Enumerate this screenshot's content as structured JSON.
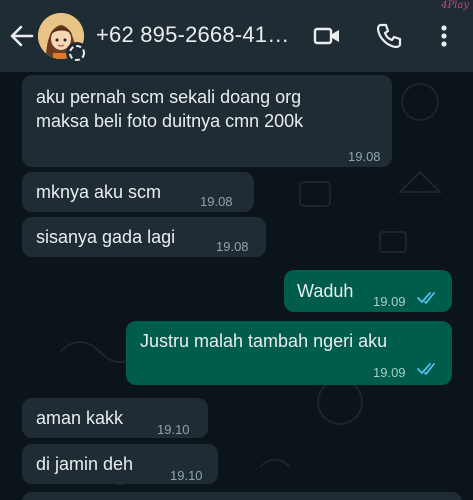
{
  "watermark": "4Play",
  "header": {
    "contact_name": "+62 895-2668-41…",
    "icons": [
      "back-arrow-icon",
      "video-call-icon",
      "voice-call-icon",
      "more-options-icon"
    ]
  },
  "messages": [
    {
      "direction": "in",
      "lines": [
        "aku pernah scm sekali doang org",
        "maksa beli foto duitnya cmn 200k"
      ],
      "time": "19.08"
    },
    {
      "direction": "in",
      "lines": [
        "mknya aku scm"
      ],
      "time": "19.08"
    },
    {
      "direction": "in",
      "lines": [
        "sisanya gada lagi"
      ],
      "time": "19.08"
    },
    {
      "direction": "out",
      "lines": [
        "Waduh"
      ],
      "time": "19.09",
      "status": "read"
    },
    {
      "direction": "out",
      "lines": [
        "Justru malah tambah ngeri aku"
      ],
      "time": "19.09",
      "status": "read"
    },
    {
      "direction": "in",
      "lines": [
        "aman kakk"
      ],
      "time": "19.10"
    },
    {
      "direction": "in",
      "lines": [
        "di jamin deh"
      ],
      "time": "19.10"
    }
  ],
  "colors": {
    "header_bg": "#202c33",
    "chat_bg": "#0b141a",
    "incoming_bubble": "#202c33",
    "outgoing_bubble": "#005c4b",
    "read_ticks": "#53bdeb"
  }
}
